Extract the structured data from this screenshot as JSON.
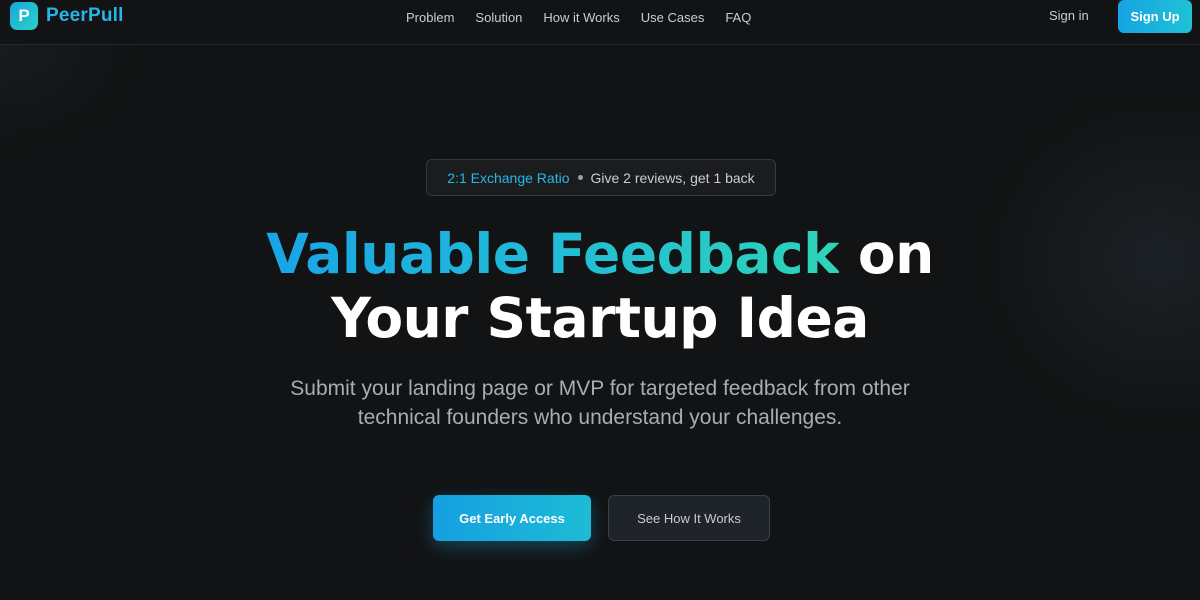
{
  "brand": {
    "logo_letter": "P",
    "name": "PeerPull",
    "accent": "#27b4e8"
  },
  "nav": {
    "items": [
      {
        "label": "Problem"
      },
      {
        "label": "Solution"
      },
      {
        "label": "How it Works"
      },
      {
        "label": "Use Cases"
      },
      {
        "label": "FAQ"
      }
    ],
    "sign_in": "Sign in",
    "sign_up": "Sign Up"
  },
  "hero": {
    "badge_accent": "2:1 Exchange Ratio",
    "badge_text": "Give 2 reviews, get 1 back",
    "headline_gradient": "Valuable Feedback",
    "headline_rest_line1": "on",
    "headline_line2": "Your Startup Idea",
    "subtitle_line1": "Submit your landing page or MVP for targeted feedback from other",
    "subtitle_line2": "technical founders who understand your challenges.",
    "primary_cta": "Get Early Access",
    "secondary_cta": "See How It Works"
  },
  "colors": {
    "background": "#121314",
    "gradient_start": "#1aa4e6",
    "gradient_end": "#2fd4b8"
  }
}
